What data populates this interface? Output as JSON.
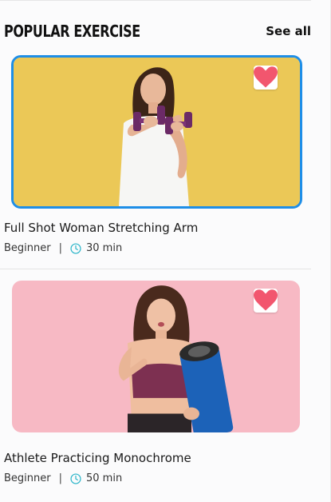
{
  "section": {
    "title": "POPULAR EXERCISE",
    "see_all_label": "See all"
  },
  "colors": {
    "accent_blue": "#1e8ee7",
    "heart_pink": "#f2566e",
    "clock_teal": "#2bb5c9",
    "card1_bg": "#e9c451",
    "card2_bg": "#f7b9c4"
  },
  "exercises": [
    {
      "title": "Full Shot Woman Stretching Arm",
      "level": "Beginner",
      "duration": "30 min",
      "favorite_icon": "heart-icon",
      "clock_icon": "clock-icon"
    },
    {
      "title": "Athlete Practicing Monochrome",
      "level": "Beginner",
      "duration": "50 min",
      "favorite_icon": "heart-icon",
      "clock_icon": "clock-icon"
    }
  ]
}
